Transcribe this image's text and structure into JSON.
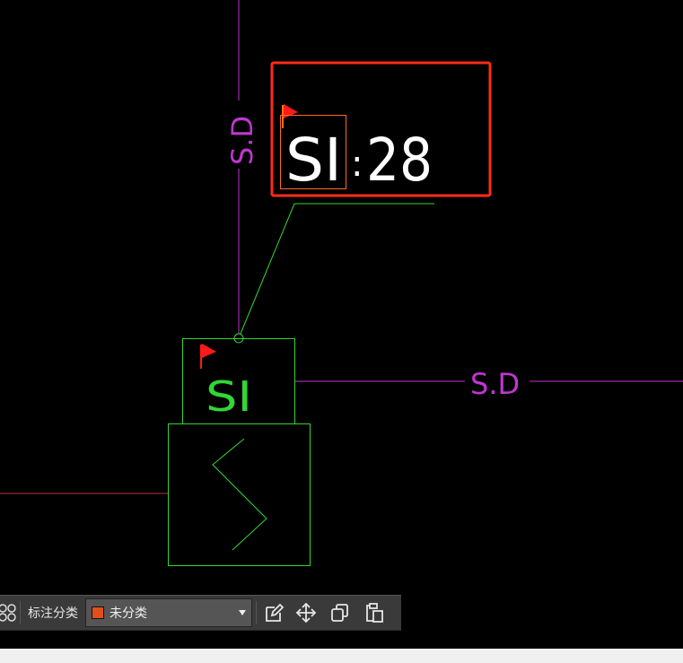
{
  "drawing": {
    "pipe_label_vertical": "S.D",
    "pipe_label_horizontal": "S.D",
    "equipment_code": "SI",
    "callout_code": "SI",
    "callout_separator": ":",
    "callout_number": "28"
  },
  "colors": {
    "background": "#000000",
    "pipe": "#c036d0",
    "equipment": "#33d633",
    "highlight": "#ff2a1a",
    "selection": "#ff6a1a",
    "flag": "#ff1a1a",
    "callout_text": "#ffffff",
    "branch_line": "#c0304a"
  },
  "toolbar": {
    "grid_icon": "grid-icon",
    "category_label": "标注分类",
    "category_value": "未分类",
    "category_color": "#e0501a",
    "edit_icon": "edit-icon",
    "move_icon": "move-icon",
    "copy_icon": "copy-icon",
    "paste_icon": "paste-icon"
  }
}
